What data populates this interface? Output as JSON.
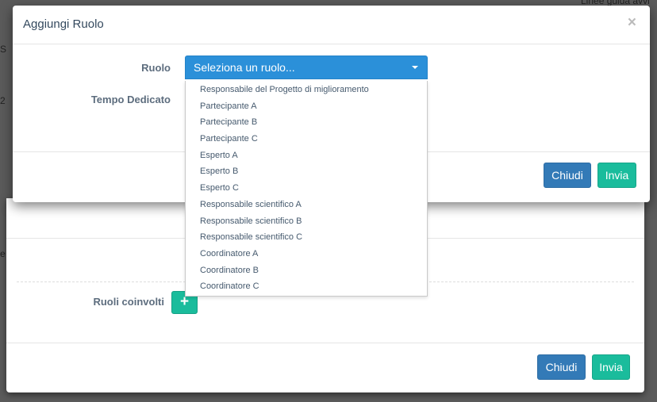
{
  "background": {
    "top_right_text": "Linee guida avvi",
    "left_fragments": [
      "S",
      "2",
      "e"
    ]
  },
  "back_modal": {
    "roles_label": "Ruoli coinvolti",
    "add_icon": "plus-icon",
    "close_button": "Chiudi",
    "submit_button": "Invia"
  },
  "modal": {
    "title": "Aggiungi Ruolo",
    "close_symbol": "×",
    "role_label": "Ruolo",
    "time_label": "Tempo Dedicato",
    "select_placeholder": "Seleziona un ruolo...",
    "close_button": "Chiudi",
    "submit_button": "Invia"
  },
  "dropdown": {
    "options": [
      "Responsabile del Progetto di miglioramento",
      "Partecipante A",
      "Partecipante B",
      "Partecipante C",
      "Esperto A",
      "Esperto B",
      "Esperto C",
      "Responsabile scientifico A",
      "Responsabile scientifico B",
      "Responsabile scientifico C",
      "Coordinatore A",
      "Coordinatore B",
      "Coordinatore C"
    ]
  },
  "colors": {
    "primary": "#337ab7",
    "success": "#1abc9c",
    "select": "#2b90d9"
  }
}
